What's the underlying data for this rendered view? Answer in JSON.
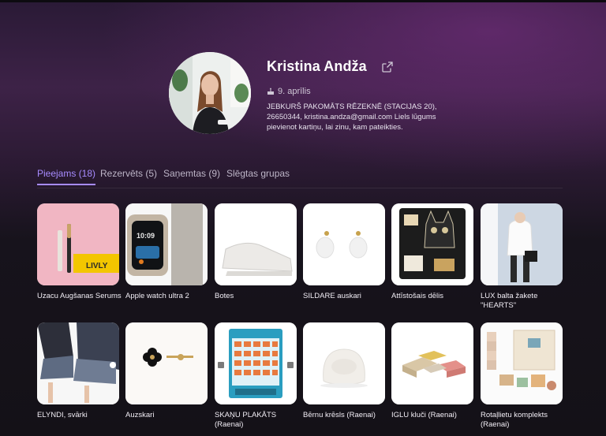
{
  "profile": {
    "name": "Kristina Andža",
    "birthday": "9. aprīlis",
    "bio": "JEBKURŠ PAKOMĀTS RĒZEKNĒ (STACIJAS 20), 26650344, kristina.andza@gmail.com Liels lūgums pievienot kartiņu, lai zinu, kam pateikties."
  },
  "tabs": [
    {
      "label": "Pieejams (18)"
    },
    {
      "label": "Rezervēts (5)"
    },
    {
      "label": "Saņemtas (9)"
    },
    {
      "label": "Slēgtas grupas"
    }
  ],
  "items": [
    {
      "title": "Uzacu Augšanas Serums",
      "image": "serum-product"
    },
    {
      "title": "Apple watch ultra 2",
      "image": "smartwatch"
    },
    {
      "title": "Botes",
      "image": "sneakers"
    },
    {
      "title": "SILDARE auskari",
      "image": "earrings-flowers"
    },
    {
      "title": "Attīstošais dēlis",
      "image": "busy-board-cat"
    },
    {
      "title": "LUX balta žakete \"HEARTS\"",
      "image": "white-jacket"
    },
    {
      "title": "ELYNDI, svārki",
      "image": "pleated-skirt"
    },
    {
      "title": "Auzskari",
      "image": "clover-earrings"
    },
    {
      "title": "SKAŅU PLAKĀTS (Raenai)",
      "image": "sound-poster"
    },
    {
      "title": "Bērnu krēsls (Raenai)",
      "image": "kids-chair"
    },
    {
      "title": "IGLU kluči (Raenai)",
      "image": "blocks"
    },
    {
      "title": "Rotaļlietu komplekts (Raenai)",
      "image": "toy-set"
    }
  ],
  "product_labels": {
    "serum_box": "LIVLY",
    "watch_time": "10:09"
  },
  "colors": {
    "accent": "#a78bff",
    "background": "#141117"
  }
}
